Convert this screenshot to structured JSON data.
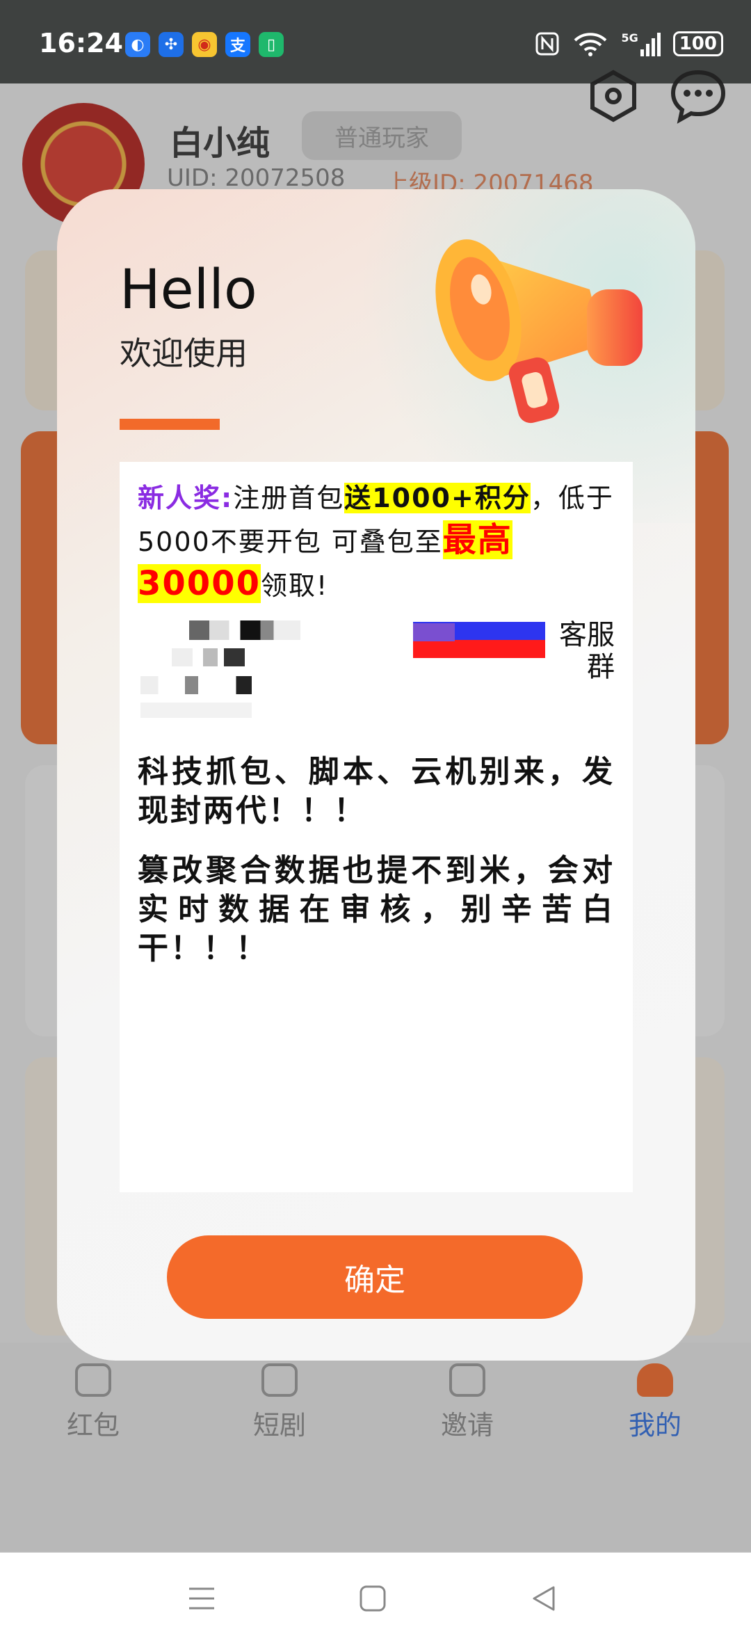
{
  "status_bar": {
    "time": "16:24",
    "battery": "100",
    "network": "5G",
    "notification_icons": [
      "browser-icon",
      "pinwheel-icon",
      "weibo-icon",
      "alipay-icon",
      "phone-manager-icon"
    ]
  },
  "profile": {
    "name": "白小纯",
    "level": "普通玩家",
    "uid": "UID: 20072508",
    "parent_id": "上级ID: 20071468"
  },
  "tabs": [
    {
      "label": "红包",
      "icon": "red-envelope-icon"
    },
    {
      "label": "短剧",
      "icon": "short-drama-icon"
    },
    {
      "label": "邀请",
      "icon": "invite-icon"
    },
    {
      "label": "我的",
      "icon": "me-icon",
      "active": true
    }
  ],
  "dialog": {
    "hello": "Hello",
    "welcome": "欢迎使用",
    "promo": {
      "label": "新人奖:",
      "t1": "注册首包",
      "hl1": "送1000+积分",
      "t2": "，低于5000不要开包 可叠包至",
      "hl2": "最高30000",
      "t3": "领取!"
    },
    "contact_label": "客服群",
    "warning1": "科技抓包、脚本、云机别来，发现封两代！！！",
    "warning2": "篡改聚合数据也提不到米，会对实时数据在审核，别辛苦白干！！！",
    "confirm": "确定"
  },
  "colors": {
    "accent": "#f46a2a",
    "active_tab": "#2f6ee0",
    "promo_label": "#8a2be2",
    "highlight": "#ffff00",
    "highlight_red": "#ff0000"
  }
}
